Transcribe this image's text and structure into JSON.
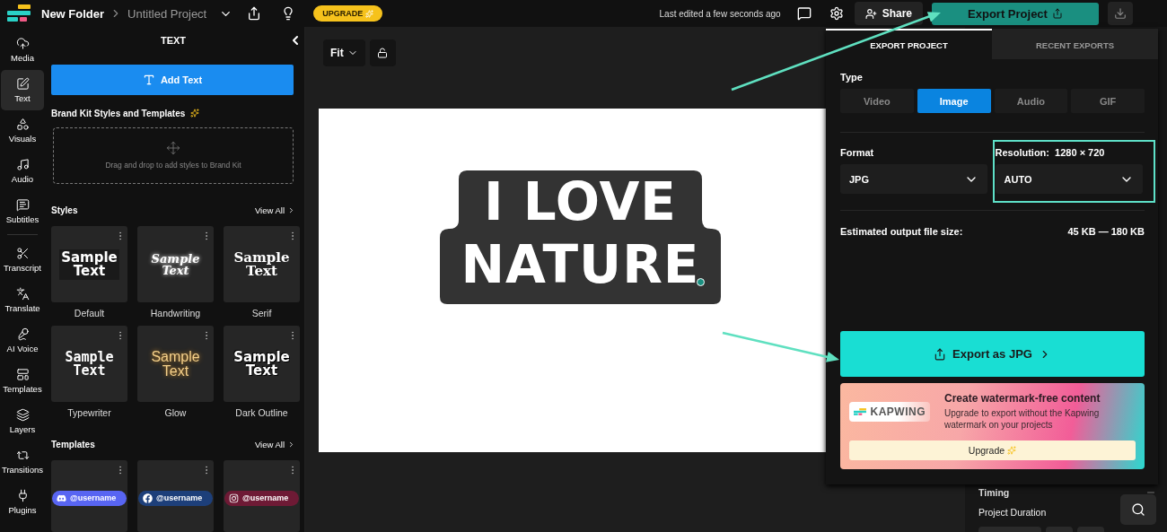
{
  "topbar": {
    "folder": "New Folder",
    "project": "Untitled Project",
    "upgrade": "UPGRADE",
    "last_edited": "Last edited a few seconds ago",
    "share": "Share",
    "export": "Export Project"
  },
  "nav": {
    "primary": [
      {
        "label": "Media",
        "selected": false
      },
      {
        "label": "Text",
        "selected": true
      },
      {
        "label": "Visuals",
        "selected": false
      },
      {
        "label": "Audio",
        "selected": false
      },
      {
        "label": "Subtitles",
        "selected": false
      }
    ],
    "secondary": [
      {
        "label": "Transcript",
        "selected": false
      },
      {
        "label": "Translate",
        "selected": false
      },
      {
        "label": "AI Voice",
        "selected": false
      },
      {
        "label": "Templates",
        "selected": false
      },
      {
        "label": "Layers",
        "selected": false
      },
      {
        "label": "Transitions",
        "selected": false
      },
      {
        "label": "Plugins",
        "selected": false
      }
    ]
  },
  "text_panel": {
    "title": "TEXT",
    "add_button": "Add Text",
    "brand_title": "Brand Kit Styles and Templates",
    "drop_hint": "Drag and drop to add styles to Brand Kit",
    "styles_title": "Styles",
    "styles_link": "View All",
    "styles": [
      {
        "kind": "default",
        "sample": "Sample Text",
        "label": "Default"
      },
      {
        "kind": "handwriting",
        "sample": "Sample Text",
        "label": "Handwriting"
      },
      {
        "kind": "serif",
        "sample": "Sample Text",
        "label": "Serif"
      },
      {
        "kind": "typewriter",
        "sample": "Sample Text",
        "label": "Typewriter"
      },
      {
        "kind": "glow",
        "sample": "Sample Text",
        "label": "Glow"
      },
      {
        "kind": "outline",
        "sample": "Sample Text",
        "label": "Dark Outline"
      }
    ],
    "templates_title": "Templates",
    "templates_link": "View All",
    "templates": [
      {
        "kind": "discord",
        "handle": "@username",
        "color": "#5865f2"
      },
      {
        "kind": "facebook",
        "handle": "@username",
        "color": "#1d3f7a"
      },
      {
        "kind": "instagram",
        "handle": "@username",
        "color": "#6e1a35"
      }
    ]
  },
  "canvas": {
    "zoom": "Fit",
    "lines": [
      "I LOVE",
      "NATURE"
    ]
  },
  "export": {
    "tabs": [
      {
        "label": "EXPORT PROJECT",
        "selected": true
      },
      {
        "label": "RECENT EXPORTS",
        "selected": false
      }
    ],
    "type_label": "Type",
    "types": [
      {
        "label": "Video",
        "selected": false
      },
      {
        "label": "Image",
        "selected": true
      },
      {
        "label": "Audio",
        "selected": false
      },
      {
        "label": "GIF",
        "selected": false
      }
    ],
    "format_label": "Format",
    "format": "JPG",
    "resolution_label": "Resolution:  1280 × 720",
    "resolution": "AUTO",
    "size_label": "Estimated output file size:",
    "size_value": "45 KB — 180 KB",
    "export_button": "Export as JPG",
    "promo": {
      "logo": "KAPWING",
      "title": "Create watermark-free content",
      "text": "Upgrade to export without the Kapwing watermark on your projects",
      "button": "Upgrade"
    }
  },
  "timing": {
    "title": "Timing",
    "duration_label": "Project Duration"
  }
}
